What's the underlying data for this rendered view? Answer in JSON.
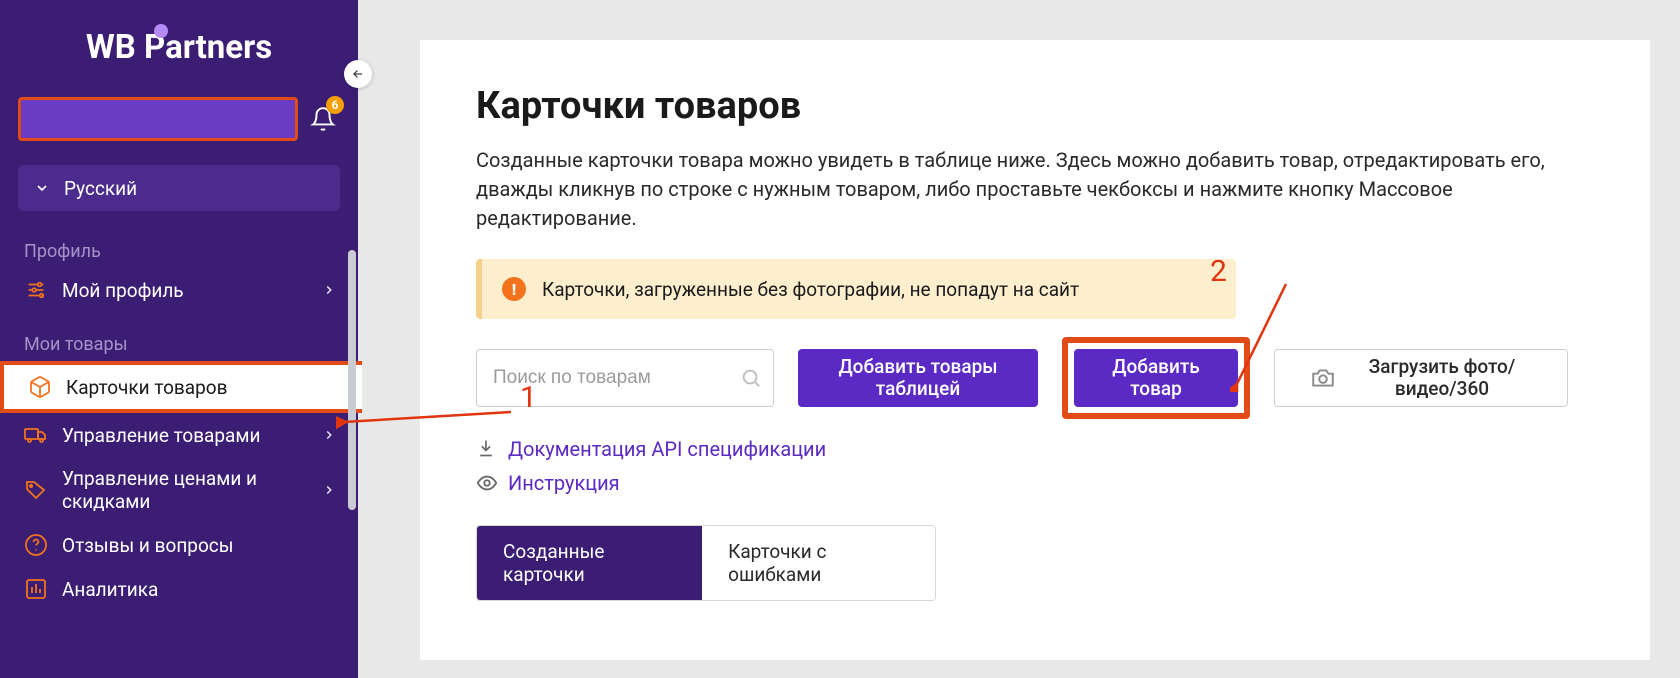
{
  "brand": {
    "logo_text": "WB  Partners"
  },
  "sidebar": {
    "notifications_count": "6",
    "language": "Русский",
    "section_profile": "Профиль",
    "section_goods": "Мои товары",
    "items": {
      "profile": "Мой профиль",
      "cards": "Карточки товаров",
      "manage_goods": "Управление товарами",
      "manage_prices": "Управление ценами и скидками",
      "reviews": "Отзывы и вопросы",
      "analytics": "Аналитика"
    }
  },
  "main": {
    "title": "Карточки товаров",
    "description": "Созданные карточки товара можно увидеть в таблице ниже. Здесь можно добавить товар, отредактировать его, дважды кликнув по строке с нужным товаром, либо проставьте чекбоксы и нажмите кнопку Массовое редактирование.",
    "alert": "Карточки, загруженные без фотографии, не попадут на сайт",
    "search_placeholder": "Поиск по товарам",
    "btn_add_table": "Добавить товары таблицей",
    "btn_add_single": "Добавить товар",
    "btn_upload_media": "Загрузить фото/видео/360",
    "link_api": "Документация API спецификации",
    "link_instr": "Инструкция",
    "tab_created": "Созданные карточки",
    "tab_errors": "Карточки с ошибками"
  },
  "annotations": {
    "one": "1",
    "two": "2"
  }
}
